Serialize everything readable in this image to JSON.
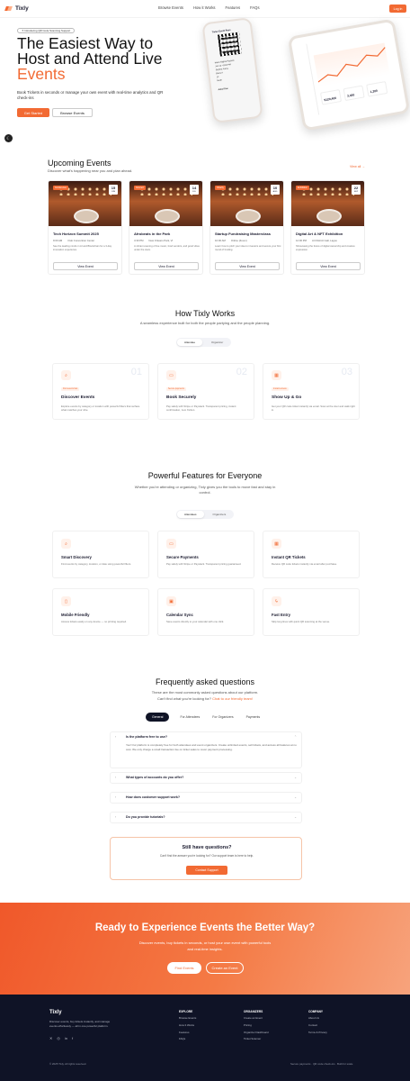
{
  "nav": {
    "logo": "Tixly",
    "links": [
      "Browse Events",
      "How it Works",
      "Features",
      "FAQs"
    ],
    "login": "Log in"
  },
  "hero": {
    "tag": "✦ Introducing QR Code Scanning Support",
    "title_1": "The Easiest Way to",
    "title_2": "Host and Attend Live",
    "title_3": "Events",
    "subtitle": "Book Tickets in seconds or manage your own event with real-time analytics and QR check-ins",
    "cta_primary": "Get Started",
    "cta_secondary": "Browse Events",
    "phone": {
      "title": "Tixlee Event Pass",
      "lines": [
        "Date",
        "Venue",
        "Section",
        "Seat",
        "Gate"
      ],
      "values": [
        "Metro Nights Festival",
        "Jan 12 • 8:00 PM",
        "Skyline Arena",
        "Block A",
        "12",
        "North"
      ],
      "holder": "Adeel Doe"
    },
    "tablet": {
      "stats": [
        "$120,400",
        "3,450",
        "1,200"
      ]
    }
  },
  "upcoming": {
    "title": "Upcoming Events",
    "subtitle": "Discover what's happening near you and plan ahead.",
    "view_all": "View all →",
    "cards": [
      {
        "tag": "Conference",
        "day": "15",
        "month": "JUN",
        "name": "Tech Horizon Summit 2025",
        "time": "9:00 AM",
        "place": "Oslo Convention Center",
        "desc": "See the leading minds in AI and Blockchain for a 3-day innovation experience.",
        "btn": "View Event"
      },
      {
        "tag": "Concert",
        "day": "14",
        "month": "JUL",
        "name": "Afrobeats in the Park",
        "time": "4:30 PM",
        "place": "New Orleans Park, VI",
        "desc": "A vibrant evening of live music, food vendors, and good vibes under the stars.",
        "btn": "View Event"
      },
      {
        "tag": "Charity",
        "day": "10",
        "month": "AUG",
        "name": "Startup Fundraising Masterclass",
        "time": "10:00 AM",
        "place": "Online (Zoom)",
        "desc": "Learn how to pitch your idea to investors and secure your first round of funding.",
        "btn": "View Event"
      },
      {
        "tag": "Exhibition",
        "day": "22",
        "month": "SEP",
        "name": "Digital Art & NFT Exhibition",
        "time": "12:00 PM",
        "place": "Art District Gall, Lagos",
        "desc": "Showcasing the future of digital ownership and creative expression.",
        "btn": "View Event"
      }
    ]
  },
  "how": {
    "title": "How Tixly Works",
    "subtitle": "A seamless experience built for both the people partying and the people planning.",
    "tabs": [
      "Attendee",
      "Organizer"
    ],
    "steps": [
      {
        "num": "01",
        "badge": "Find events fast",
        "title": "Discover Events",
        "desc": "Explore events by category or location with powerful filters that surface what matches your vibe.",
        "icon": "⌕"
      },
      {
        "num": "02",
        "badge": "Secure payments",
        "title": "Book Securely",
        "desc": "Pay safely with Stripe or Paystack. Transparent pricing, instant confirmation, zero friction.",
        "icon": "▭"
      },
      {
        "num": "03",
        "badge": "Instant access",
        "title": "Show Up & Go",
        "desc": "Get your QR code ticket instantly via email. Scan at the door and walk right in.",
        "icon": "▦"
      }
    ]
  },
  "features": {
    "title": "Powerful Features for Everyone",
    "subtitle": "Whether you're attending or organizing, Tixly gives you the tools to move fast and stay in control.",
    "tabs": [
      "Attendees",
      "Organizers"
    ],
    "items": [
      {
        "title": "Smart Discovery",
        "desc": "Find events by category, location, or date using powerful filters.",
        "icon": "⌕"
      },
      {
        "title": "Secure Payments",
        "desc": "Pay safely with Stripe or Paystack. Transparent pricing guaranteed.",
        "icon": "▭"
      },
      {
        "title": "Instant QR Tickets",
        "desc": "Receive QR code tickets instantly via email after purchase.",
        "icon": "▦"
      },
      {
        "title": "Mobile Friendly",
        "desc": "Access tickets easily on any device — no printing required.",
        "icon": "▯"
      },
      {
        "title": "Calendar Sync",
        "desc": "Save events directly to your calendar with one click.",
        "icon": "▣"
      },
      {
        "title": "Fast Entry",
        "desc": "Skip long lines with quick QR scanning at the venue.",
        "icon": "ϟ"
      }
    ]
  },
  "faq": {
    "title": "Frequently asked questions",
    "subtitle_1": "These are the most commonly asked questions about our platform.",
    "subtitle_2": "Can't find what you're looking for? ",
    "subtitle_link": "Chat to our friendly team!",
    "tabs": [
      "General",
      "For Attendees",
      "For Organizers",
      "Payments"
    ],
    "items": [
      {
        "q": "Is the platform free to use?",
        "a": "Yes! Our platform is completely free for both attendees and event organizers. Create unlimited events, sell tickets, and access all features at no cost. We only charge a small transaction fee on ticket sales to cover payment processing."
      },
      {
        "q": "What types of accounts do you offer?",
        "a": ""
      },
      {
        "q": "How does customer support work?",
        "a": ""
      },
      {
        "q": "Do you provide tutorials?",
        "a": ""
      }
    ],
    "still_title": "Still have questions?",
    "still_desc": "Can't find the answer you're looking for? Our support team is here to help.",
    "still_btn": "Contact Support"
  },
  "cta": {
    "title": "Ready to Experience Events the Better Way?",
    "desc_1": "Discover events, buy tickets in seconds, or host your own event with powerful tools",
    "desc_2": "and real-time insights.",
    "btn_1": "Find Events",
    "btn_2": "Create an Event"
  },
  "footer": {
    "brand": "Tixly",
    "desc_1": "Discover events, buy tickets instantly, and manage",
    "desc_2": "events effortlessly — all in one powerful platform.",
    "cols": [
      {
        "title": "EXPLORE",
        "links": [
          "Browse Events",
          "How It Works",
          "Features",
          "FAQs"
        ]
      },
      {
        "title": "ORGANIZERS",
        "links": [
          "Create an Event",
          "Pricing",
          "Organizer Dashboard",
          "Ticket Scanner"
        ]
      },
      {
        "title": "COMPANY",
        "links": [
          "About Us",
          "Contact",
          "Terms & Privacy"
        ]
      }
    ],
    "copyright": "© 2025 Tixly. All rights reserved.",
    "bottom_right": "Secure payments · QR code check-ins · Built for scale"
  },
  "colors": {
    "accent": "#f26a33",
    "dark": "#0f1326"
  }
}
